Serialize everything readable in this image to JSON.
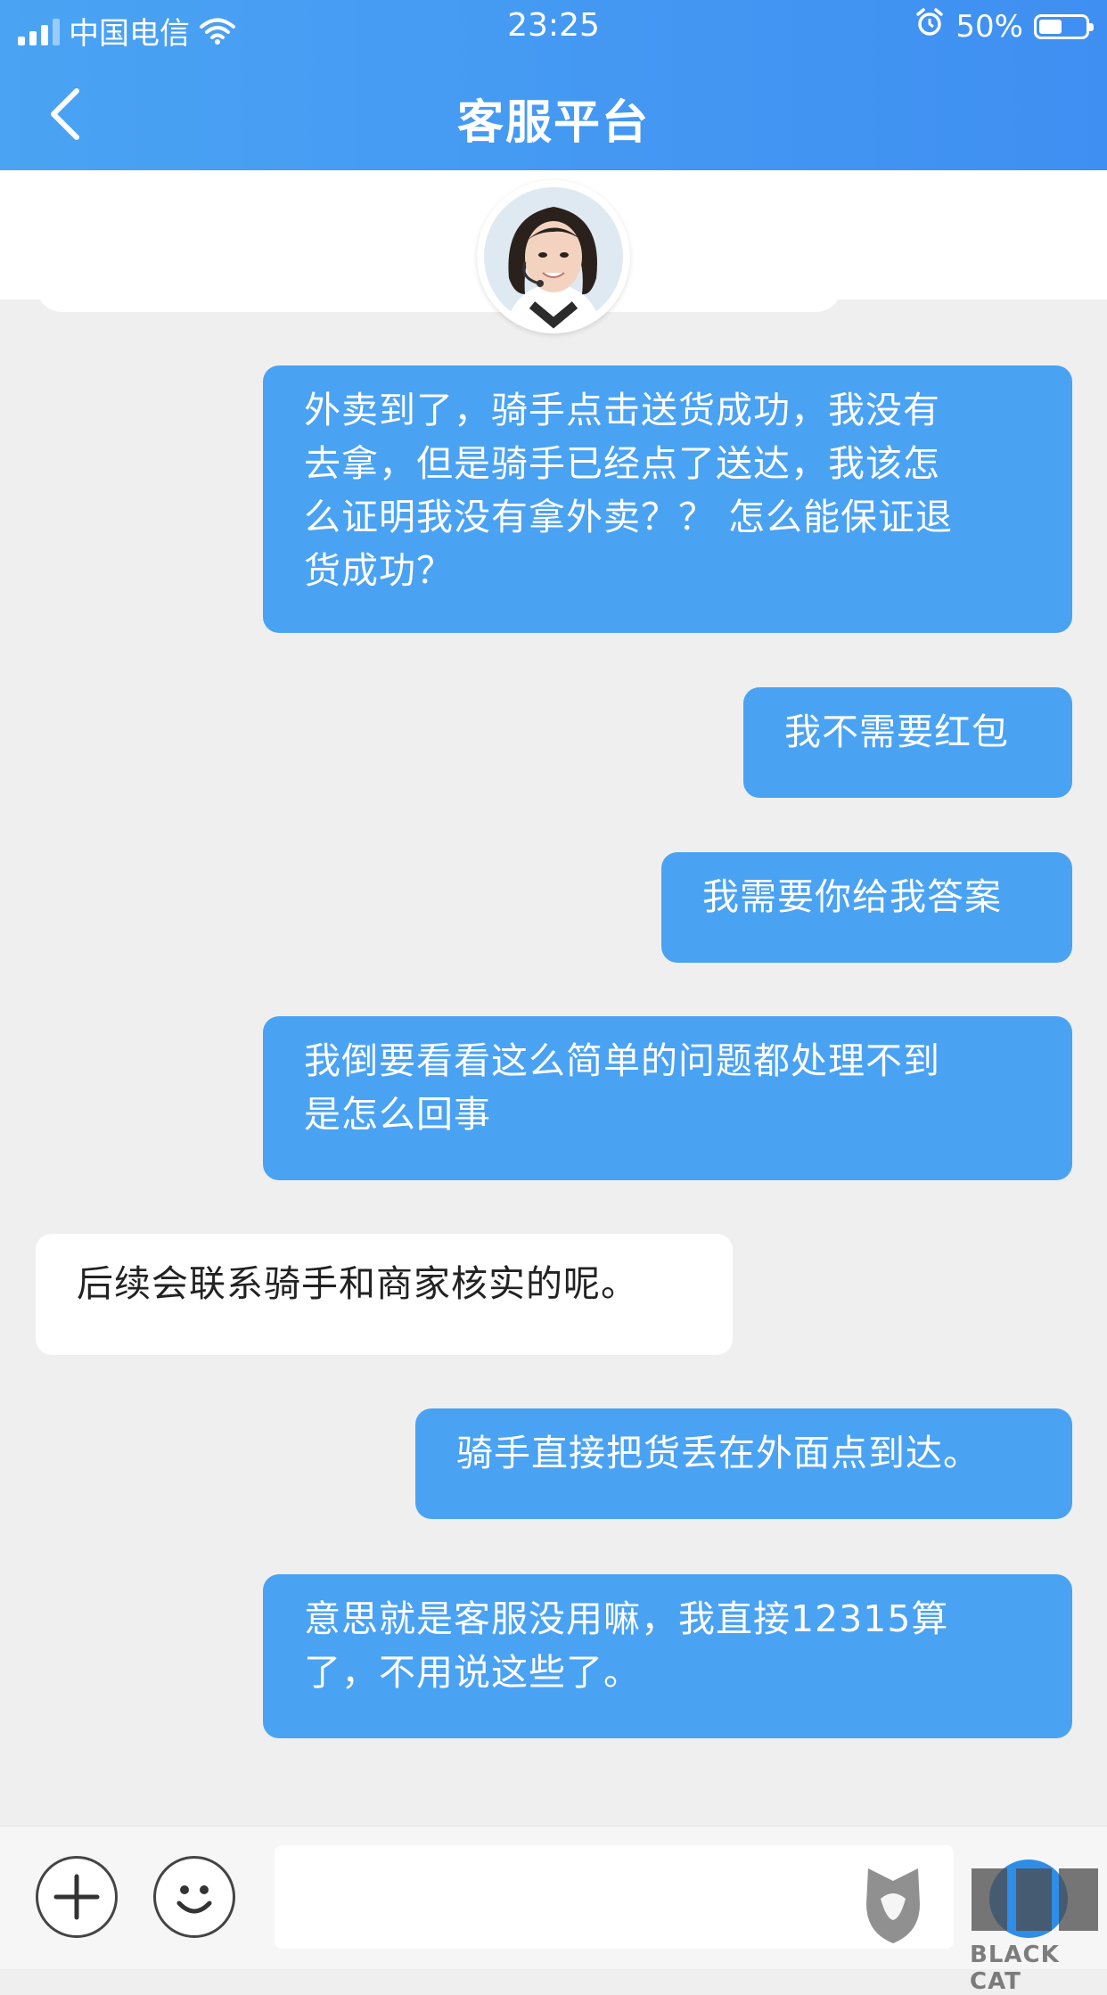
{
  "status_bar": {
    "carrier": "中国电信",
    "time": "23:25",
    "battery": "50%",
    "battery_level": 0.5
  },
  "nav": {
    "title": "客服平台"
  },
  "messages": [
    {
      "from": "me",
      "text": "外卖到了，骑手点击送货成功，我没有\n去拿，但是骑手已经点了送达，我该怎\n么证明我没有拿外卖？？ 怎么能保证退\n货成功？"
    },
    {
      "from": "me",
      "text": "我不需要红包"
    },
    {
      "from": "me",
      "text": "我需要你给我答案"
    },
    {
      "from": "me",
      "text": "我倒要看看这么简单的问题都处理不到\n是怎么回事"
    },
    {
      "from": "agent",
      "text": "后续会联系骑手和商家核实的呢。"
    },
    {
      "from": "me",
      "text": "骑手直接把货丢在外面点到达。"
    },
    {
      "from": "me",
      "text": "意思就是客服没用嘛，我直接12315算\n了，不用说这些了。"
    }
  ],
  "watermark": {
    "text": "BLACK CAT"
  },
  "colors": {
    "header": "#4aa3f3",
    "my_bubble": "#4aa2f3",
    "agent_bubble": "#ffffff",
    "background": "#efefef"
  }
}
